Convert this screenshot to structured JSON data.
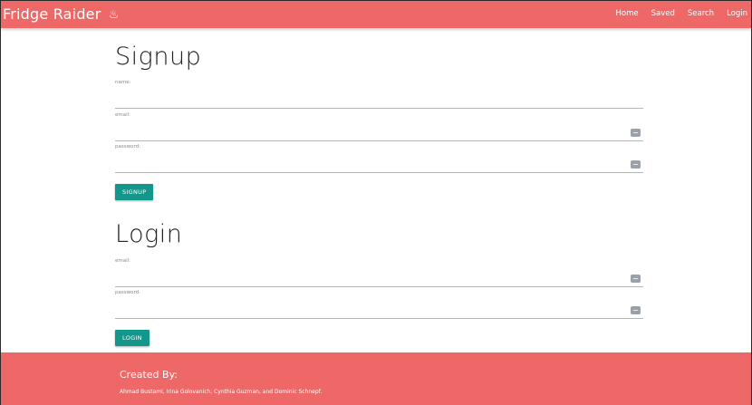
{
  "navbar": {
    "brand": "Fridge Raider",
    "brand_icon": "steaming-bowl-icon",
    "links": [
      {
        "label": "Home"
      },
      {
        "label": "Saved"
      },
      {
        "label": "Search"
      },
      {
        "label": "Login"
      }
    ]
  },
  "signup": {
    "title": "Signup",
    "name_label": "name:",
    "email_label": "email:",
    "password_label": "password:",
    "button": "SIGNUP"
  },
  "login": {
    "title": "Login",
    "email_label": "email:",
    "password_label": "password:",
    "button": "LOGIN"
  },
  "footer": {
    "title": "Created By:",
    "names": "Ahmad Bustami, Irina Golovanich, Cynthia Guzman, and Dominic Schnepf."
  },
  "colors": {
    "primary": "#ee6868",
    "button": "#14978b"
  }
}
